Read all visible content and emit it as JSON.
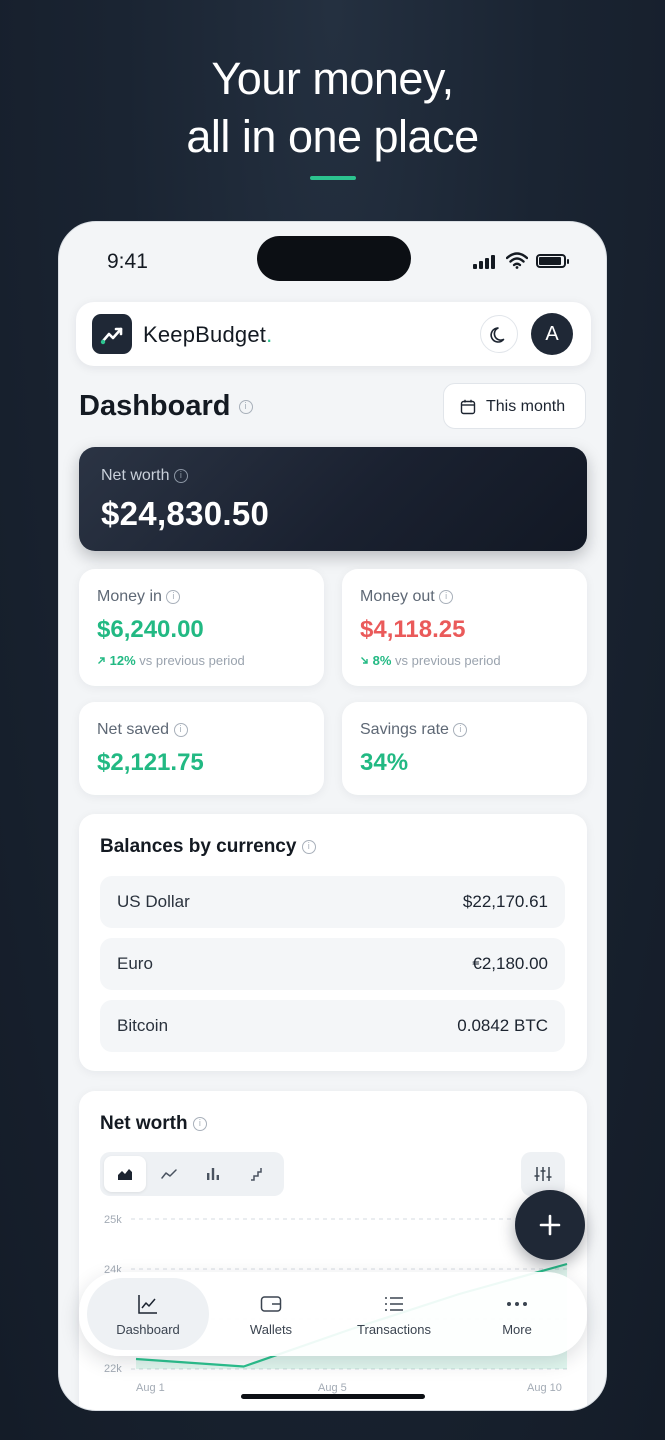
{
  "headline": {
    "line1": "Your money,",
    "line2": "all in one place"
  },
  "status_bar": {
    "time": "9:41"
  },
  "app": {
    "brand_name": "KeepBudget",
    "brand_dot": ".",
    "avatar_initial": "A"
  },
  "dashboard": {
    "title": "Dashboard",
    "period_label": "This month"
  },
  "net_worth": {
    "label": "Net worth",
    "value": "$24,830.50"
  },
  "stats": {
    "money_in": {
      "label": "Money in",
      "value": "$6,240.00",
      "trend": "12%",
      "trend_text": "vs previous period"
    },
    "money_out": {
      "label": "Money out",
      "value": "$4,118.25",
      "trend": "8%",
      "trend_text": "vs previous period"
    },
    "net_saved": {
      "label": "Net saved",
      "value": "$2,121.75"
    },
    "savings_rate": {
      "label": "Savings rate",
      "value": "34%"
    }
  },
  "balances": {
    "title": "Balances by currency",
    "rows": [
      {
        "name": "US Dollar",
        "value": "$22,170.61"
      },
      {
        "name": "Euro",
        "value": "€2,180.00"
      },
      {
        "name": "Bitcoin",
        "value": "0.0842 BTC"
      }
    ]
  },
  "net_worth_chart": {
    "title": "Net worth",
    "chart_types": [
      "area-chart-icon",
      "line-chart-icon",
      "bar-chart-icon",
      "step-chart-icon"
    ],
    "selected_type": "area",
    "y_ticks": [
      "25k",
      "24k",
      "22k"
    ],
    "x_ticks": [
      "Aug 1",
      "Aug 5",
      "Aug 10"
    ]
  },
  "chart_data": {
    "type": "area",
    "title": "Net worth",
    "xlabel": "",
    "ylabel": "",
    "x": [
      "Aug 1",
      "Aug 3",
      "Aug 5",
      "Aug 8",
      "Aug 10"
    ],
    "values": [
      22200,
      22050,
      22800,
      23500,
      24100
    ],
    "ylim": [
      22000,
      25000
    ],
    "grid": true
  },
  "bottom_nav": [
    {
      "label": "Dashboard",
      "icon": "chart-icon",
      "active": true
    },
    {
      "label": "Wallets",
      "icon": "wallet-icon",
      "active": false
    },
    {
      "label": "Transactions",
      "icon": "list-icon",
      "active": false
    },
    {
      "label": "More",
      "icon": "more-icon",
      "active": false
    }
  ],
  "colors": {
    "accent": "#2cc38f",
    "positive": "#22b983",
    "negative": "#ea5a5a",
    "dark": "#1f2836"
  }
}
